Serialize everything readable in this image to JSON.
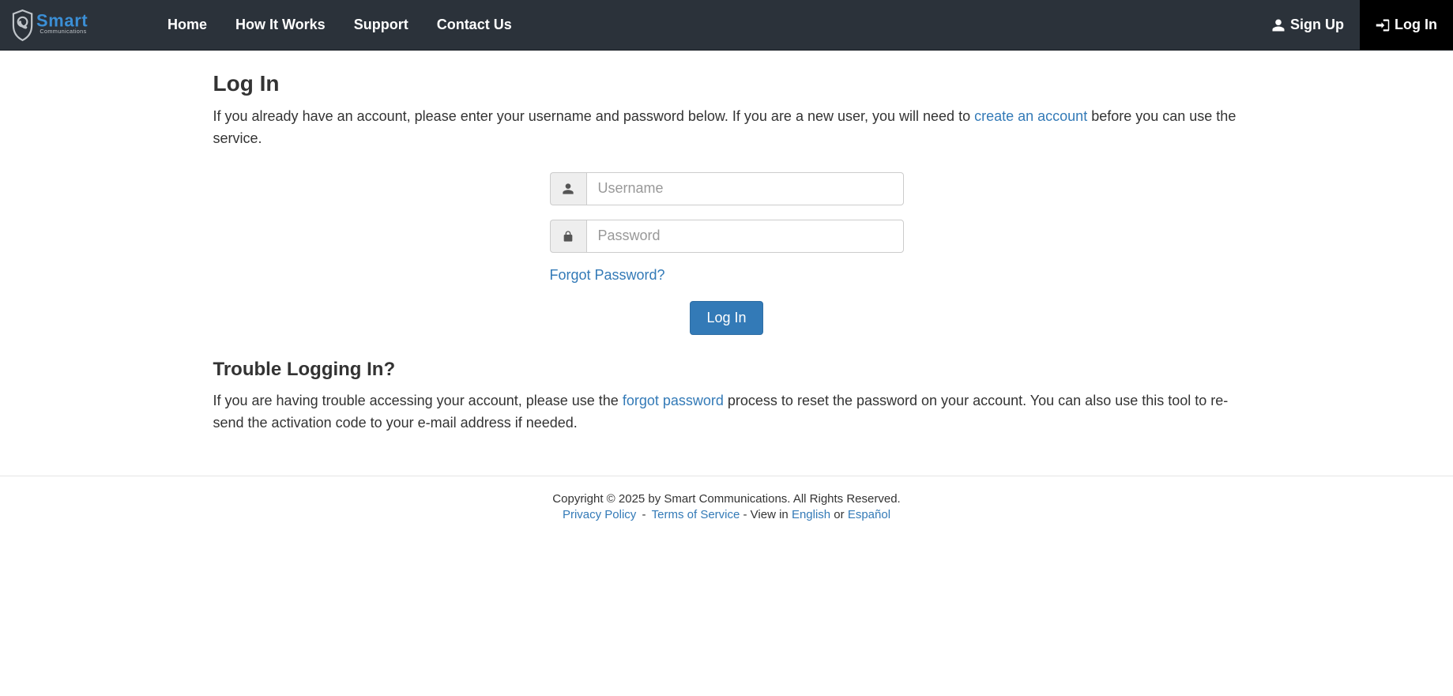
{
  "brand": {
    "main": "Smart",
    "sub": "Communications"
  },
  "nav": {
    "home": "Home",
    "how_it_works": "How It Works",
    "support": "Support",
    "contact_us": "Contact Us",
    "sign_up": "Sign Up",
    "log_in": "Log In"
  },
  "page": {
    "title": "Log In",
    "intro_before": "If you already have an account, please enter your username and password below. If you are a new user, you will need to ",
    "create_account_link": "create an account",
    "intro_after": " before you can use the service."
  },
  "form": {
    "username_placeholder": "Username",
    "password_placeholder": "Password",
    "forgot": "Forgot Password?",
    "submit": "Log In"
  },
  "trouble": {
    "heading": "Trouble Logging In?",
    "before": "If you are having trouble accessing your account, please use the ",
    "link": "forgot password",
    "after": " process to reset the password on your account. You can also use this tool to re-send the activation code to your e-mail address if needed."
  },
  "footer": {
    "copyright": "Copyright © 2025 by Smart Communications. All Rights Reserved.",
    "privacy": "Privacy Policy",
    "sep": " - ",
    "terms": "Terms of Service",
    "view_in": " - View in ",
    "english": "English",
    "or": " or ",
    "espanol": "Español"
  }
}
